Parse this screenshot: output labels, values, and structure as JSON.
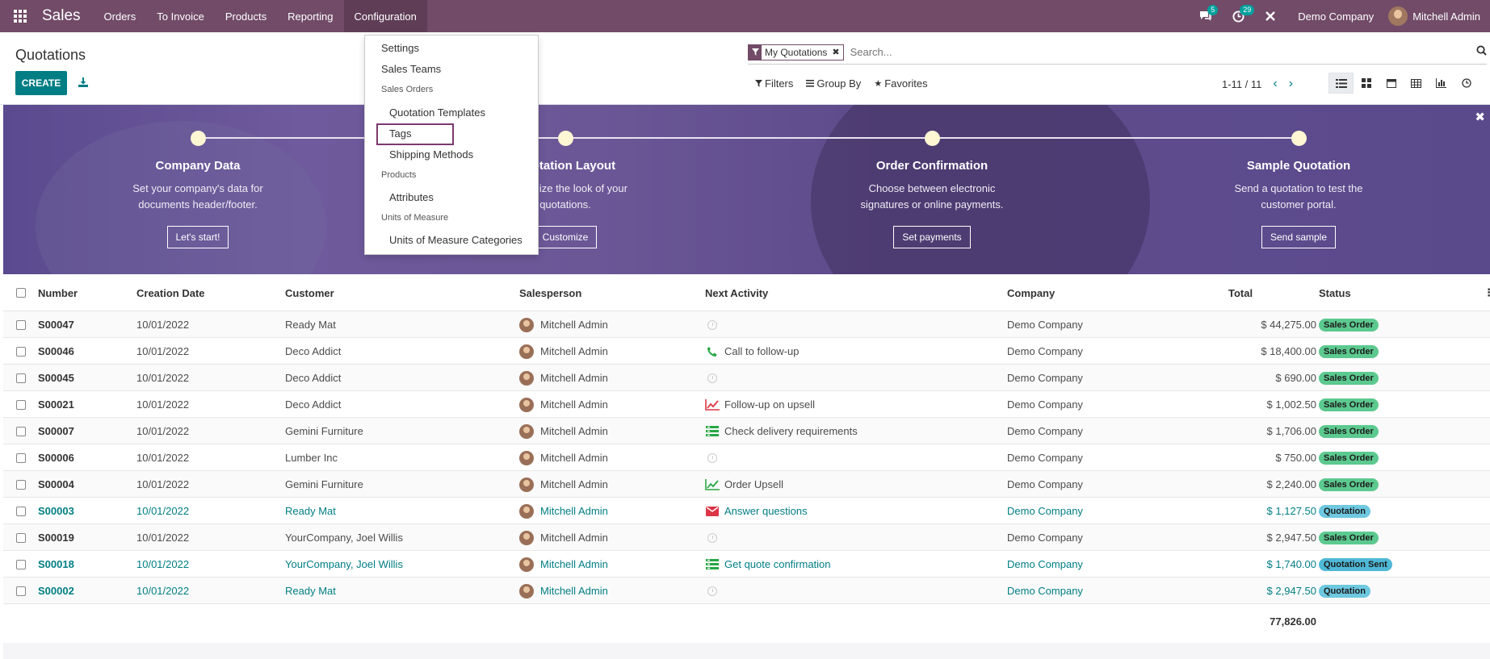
{
  "nav": {
    "brand": "Sales",
    "menu": [
      "Orders",
      "To Invoice",
      "Products",
      "Reporting",
      "Configuration"
    ],
    "messages_count": "5",
    "activities_count": "29",
    "company": "Demo Company",
    "user": "Mitchell Admin"
  },
  "control_panel": {
    "title": "Quotations",
    "create_label": "CREATE",
    "facet_label": "My Quotations",
    "search_placeholder": "Search...",
    "filters_label": "Filters",
    "groupby_label": "Group By",
    "favorites_label": "Favorites",
    "pager": "1-11 / 11"
  },
  "config_menu": {
    "settings": "Settings",
    "sales_teams": "Sales Teams",
    "sales_orders_header": "Sales Orders",
    "quotation_templates": "Quotation Templates",
    "tags": "Tags",
    "shipping_methods": "Shipping Methods",
    "products_header": "Products",
    "attributes": "Attributes",
    "uom_header": "Units of Measure",
    "uom_categories": "Units of Measure Categories"
  },
  "banner": {
    "steps": [
      {
        "title": "Company Data",
        "desc1": "Set your company's data for",
        "desc2": "documents header/footer.",
        "button": "Let's start!"
      },
      {
        "title": "Quotation Layout",
        "desc1": "Customize the look of your",
        "desc2": "quotations.",
        "button": "Customize"
      },
      {
        "title": "Order Confirmation",
        "desc1": "Choose between electronic",
        "desc2": "signatures or online payments.",
        "button": "Set payments"
      },
      {
        "title": "Sample Quotation",
        "desc1": "Send a quotation to test the",
        "desc2": "customer portal.",
        "button": "Send sample"
      }
    ]
  },
  "table": {
    "columns": {
      "number": "Number",
      "creation_date": "Creation Date",
      "customer": "Customer",
      "salesperson": "Salesperson",
      "next_activity": "Next Activity",
      "company": "Company",
      "total": "Total",
      "status": "Status"
    },
    "rows": [
      {
        "number": "S00047",
        "date": "10/01/2022",
        "customer": "Ready Mat",
        "salesperson": "Mitchell Admin",
        "activity": "",
        "activity_icon": "clock-icon",
        "company": "Demo Company",
        "total": "$ 44,275.00",
        "status": "Sales Order",
        "kind": "order"
      },
      {
        "number": "S00046",
        "date": "10/01/2022",
        "customer": "Deco Addict",
        "salesperson": "Mitchell Admin",
        "activity": "Call to follow-up",
        "activity_icon": "phone-icon",
        "company": "Demo Company",
        "total": "$ 18,400.00",
        "status": "Sales Order",
        "kind": "order"
      },
      {
        "number": "S00045",
        "date": "10/01/2022",
        "customer": "Deco Addict",
        "salesperson": "Mitchell Admin",
        "activity": "",
        "activity_icon": "clock-icon",
        "company": "Demo Company",
        "total": "$ 690.00",
        "status": "Sales Order",
        "kind": "order"
      },
      {
        "number": "S00021",
        "date": "10/01/2022",
        "customer": "Deco Addict",
        "salesperson": "Mitchell Admin",
        "activity": "Follow-up on upsell",
        "activity_icon": "chart-red-icon",
        "company": "Demo Company",
        "total": "$ 1,002.50",
        "status": "Sales Order",
        "kind": "order"
      },
      {
        "number": "S00007",
        "date": "10/01/2022",
        "customer": "Gemini Furniture",
        "salesperson": "Mitchell Admin",
        "activity": "Check delivery requirements",
        "activity_icon": "tasks-icon",
        "company": "Demo Company",
        "total": "$ 1,706.00",
        "status": "Sales Order",
        "kind": "order"
      },
      {
        "number": "S00006",
        "date": "10/01/2022",
        "customer": "Lumber Inc",
        "salesperson": "Mitchell Admin",
        "activity": "",
        "activity_icon": "clock-icon",
        "company": "Demo Company",
        "total": "$ 750.00",
        "status": "Sales Order",
        "kind": "order"
      },
      {
        "number": "S00004",
        "date": "10/01/2022",
        "customer": "Gemini Furniture",
        "salesperson": "Mitchell Admin",
        "activity": "Order Upsell",
        "activity_icon": "chart-green-icon",
        "company": "Demo Company",
        "total": "$ 2,240.00",
        "status": "Sales Order",
        "kind": "order"
      },
      {
        "number": "S00003",
        "date": "10/01/2022",
        "customer": "Ready Mat",
        "salesperson": "Mitchell Admin",
        "activity": "Answer questions",
        "activity_icon": "envelope-icon",
        "company": "Demo Company",
        "total": "$ 1,127.50",
        "status": "Quotation",
        "kind": "quote"
      },
      {
        "number": "S00019",
        "date": "10/01/2022",
        "customer": "YourCompany, Joel Willis",
        "salesperson": "Mitchell Admin",
        "activity": "",
        "activity_icon": "clock-icon",
        "company": "Demo Company",
        "total": "$ 2,947.50",
        "status": "Sales Order",
        "kind": "order"
      },
      {
        "number": "S00018",
        "date": "10/01/2022",
        "customer": "YourCompany, Joel Willis",
        "salesperson": "Mitchell Admin",
        "activity": "Get quote confirmation",
        "activity_icon": "tasks-icon",
        "company": "Demo Company",
        "total": "$ 1,740.00",
        "status": "Quotation Sent",
        "kind": "sent"
      },
      {
        "number": "S00002",
        "date": "10/01/2022",
        "customer": "Ready Mat",
        "salesperson": "Mitchell Admin",
        "activity": "",
        "activity_icon": "clock-icon",
        "company": "Demo Company",
        "total": "$ 2,947.50",
        "status": "Quotation",
        "kind": "quote"
      }
    ],
    "grand_total": "77,826.00"
  },
  "colors": {
    "brand": "#714b67",
    "accent": "#017e84",
    "status_order": "#5cc98f",
    "status_quotation": "#6dc8e0"
  }
}
